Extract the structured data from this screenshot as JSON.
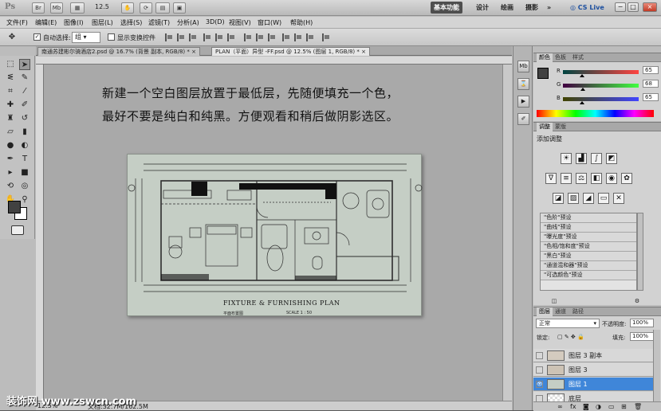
{
  "app": {
    "logo": "Ps",
    "toolbar_buttons": [
      "Br",
      "Mb"
    ],
    "zoom_value": "12.5",
    "workspaces": [
      "基本功能",
      "设计",
      "绘画",
      "摄影"
    ],
    "workspace_more": "»",
    "cs_live": "CS Live",
    "window_controls": [
      "−",
      "□",
      "×"
    ]
  },
  "menu": [
    "文件(F)",
    "编辑(E)",
    "图像(I)",
    "图层(L)",
    "选择(S)",
    "滤镜(T)",
    "分析(A)",
    "3D(D)",
    "视图(V)",
    "窗口(W)",
    "帮助(H)"
  ],
  "options": {
    "auto_select_label": "自动选择:",
    "auto_select_value": "组",
    "show_transform_label": "显示变换控件"
  },
  "tabs": [
    {
      "label": "南通苏建彬尔骑酒店2.psd @ 16.7% (背景 副本, RGB/8) *",
      "close": "×"
    },
    {
      "label": "PLAN（平面）异型 -FF.psd @ 12.5% (图层 1, RGB/8) *",
      "close": "×"
    }
  ],
  "canvas": {
    "note_line1": "新建一个空白图层放置于最低层，先随便填充一个色，",
    "note_line2": "最好不要是纯白和纯黑。方便观看和稍后做阴影选区。",
    "plan_title": "FIXTURE  &  FURNISHING  PLAN",
    "plan_subtitle": "平面布置图",
    "plan_scale": "SCALE      1 : 50"
  },
  "status": {
    "zoom": "12.5%",
    "doc": "文档:32.7M/162.5M"
  },
  "watermark": "装饰网 www.zswcn.com",
  "color_panel": {
    "tabs": [
      "颜色",
      "色板",
      "样式"
    ],
    "channels": [
      {
        "label": "R",
        "value": "65"
      },
      {
        "label": "G",
        "value": "68"
      },
      {
        "label": "B",
        "value": "65"
      }
    ],
    "foreground_color": "#414441"
  },
  "adjust_panel": {
    "tabs": [
      "调整",
      "蒙版"
    ],
    "title": "添加调整",
    "presets": [
      "\"色阶\"预设",
      "\"曲线\"预设",
      "\"曝光度\"预设",
      "\"色相/饱和度\"预设",
      "\"黑白\"预设",
      "\"通道混和器\"预设",
      "\"可选颜色\"预设"
    ]
  },
  "layers_panel": {
    "tabs": [
      "图层",
      "通道",
      "路径"
    ],
    "blend_mode": "正常",
    "opacity_label": "不透明度:",
    "opacity_value": "100%",
    "lock_label": "锁定:",
    "fill_label": "填充:",
    "fill_value": "100%",
    "layers": [
      {
        "name": "图层 3 副本",
        "visible": false,
        "selected": false
      },
      {
        "name": "图层 3",
        "visible": false,
        "selected": false
      },
      {
        "name": "图层 1",
        "visible": true,
        "selected": true
      },
      {
        "name": "底层",
        "visible": false,
        "selected": false
      }
    ]
  }
}
